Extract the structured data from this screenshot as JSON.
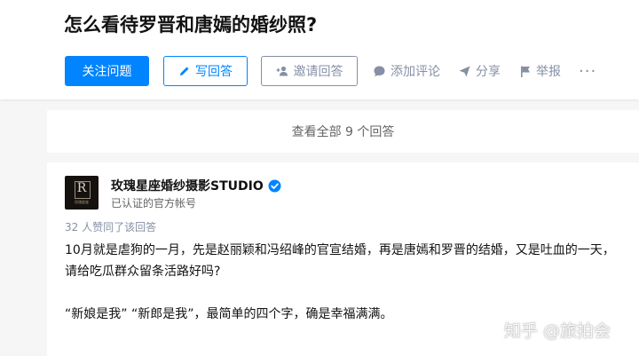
{
  "question": {
    "title": "怎么看待罗晋和唐嫣的婚纱照?"
  },
  "actions": {
    "follow_label": "关注问题",
    "write_label": "写回答",
    "invite_label": "邀请回答",
    "comment_label": "添加评论",
    "share_label": "分享",
    "report_label": "举报",
    "more_label": "···"
  },
  "all_answers": {
    "label": "查看全部 9 个回答"
  },
  "answer": {
    "author_name": "玫瑰星座婚纱摄影STUDIO",
    "author_desc": "已认证的官方帐号",
    "avatar_letter": "R",
    "avatar_sub": "玫瑰星座",
    "votes": "32 人赞同了该回答",
    "paragraphs": [
      "10月就是虐狗的一月，先是赵丽颖和冯绍峰的官宣结婚，再是唐嫣和罗晋的结婚，又是吐血的一天，请给吃瓜群众留条活路好吗?",
      "“新娘是我” “新郎是我”，最简单的四个字，确是幸福满满。"
    ]
  },
  "watermark": "知乎 @旅拍会",
  "colors": {
    "primary": "#0084ff",
    "muted": "#8590a6",
    "verified": "#0084ff"
  }
}
